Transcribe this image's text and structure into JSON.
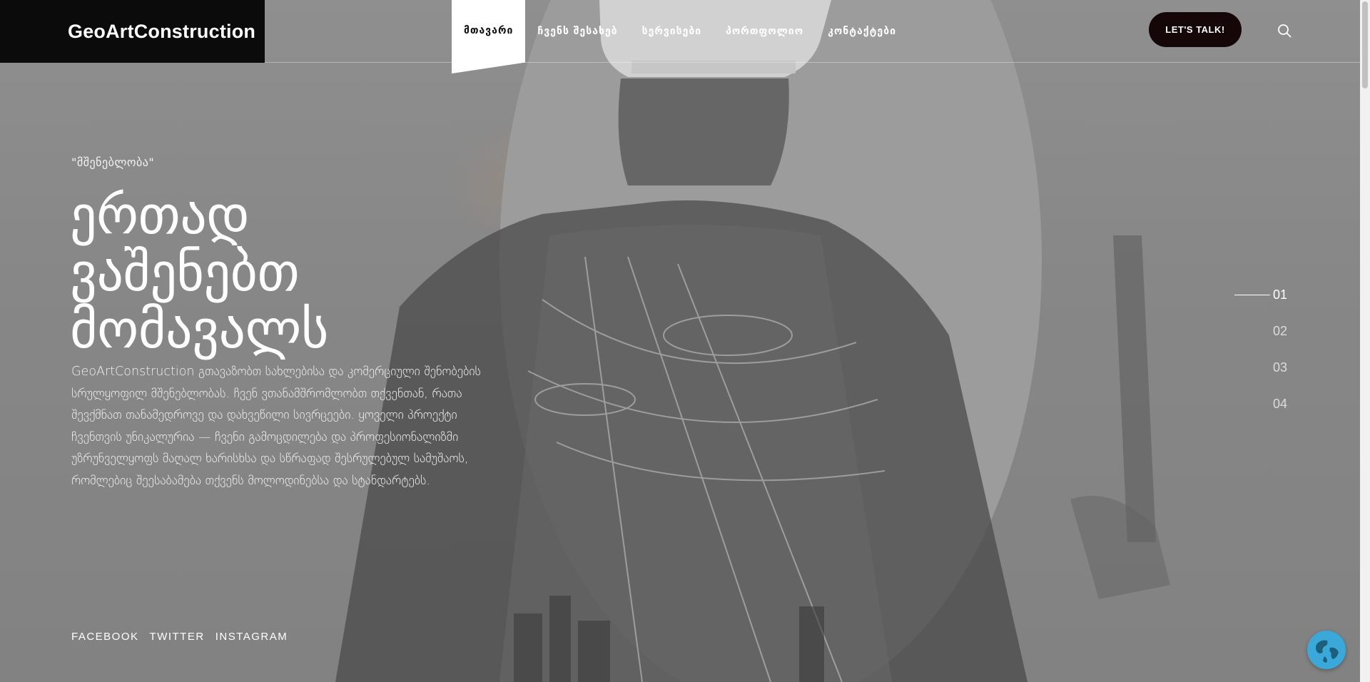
{
  "colors": {
    "logo_bg": "#0b0b0b",
    "cta_bg": "#150607",
    "globe": "#3aa8d8",
    "accent_glow": "#e88c3c"
  },
  "header": {
    "logo": "GeoArtConstruction",
    "nav": [
      {
        "label": "მთავარი",
        "active": true
      },
      {
        "label": "ჩვენს შესახებ",
        "active": false
      },
      {
        "label": "სერვისები",
        "active": false
      },
      {
        "label": "პორთფოლიო",
        "active": false
      },
      {
        "label": "კონტაქტები",
        "active": false
      }
    ],
    "cta_label": "LET'S TALK!",
    "search_icon": "search-icon"
  },
  "hero": {
    "eyebrow": "\"მშენებლობა\"",
    "headline": [
      "ერთად",
      "ვაშენებთ",
      "მომავალს"
    ],
    "description": "GeoArtConstruction გთავაზობთ სახლებისა და კომერციული შენობების სრულყოფილ მშენებლობას. ჩვენ ვთანამშრომლობთ თქვენთან, რათა შევქმნათ თანამედროვე და დახვეწილი სივრცეები. ყოველი პროექტი ჩვენთვის უნიკალურია — ჩვენი გამოცდილება და პროფესიონალიზმი უზრუნველყოფს მაღალ ხარისხსა და სწრაფად შესრულებულ სამუშაოს, რომლებიც შეესაბამება თქვენს მოლოდინებსა და სტანდარტებს."
  },
  "social": [
    "FACEBOOK",
    "TWITTER",
    "INSTAGRAM"
  ],
  "pager": {
    "items": [
      "01",
      "02",
      "03",
      "04"
    ],
    "active_index": 0
  },
  "widgets": {
    "globe_icon": "globe-icon"
  }
}
